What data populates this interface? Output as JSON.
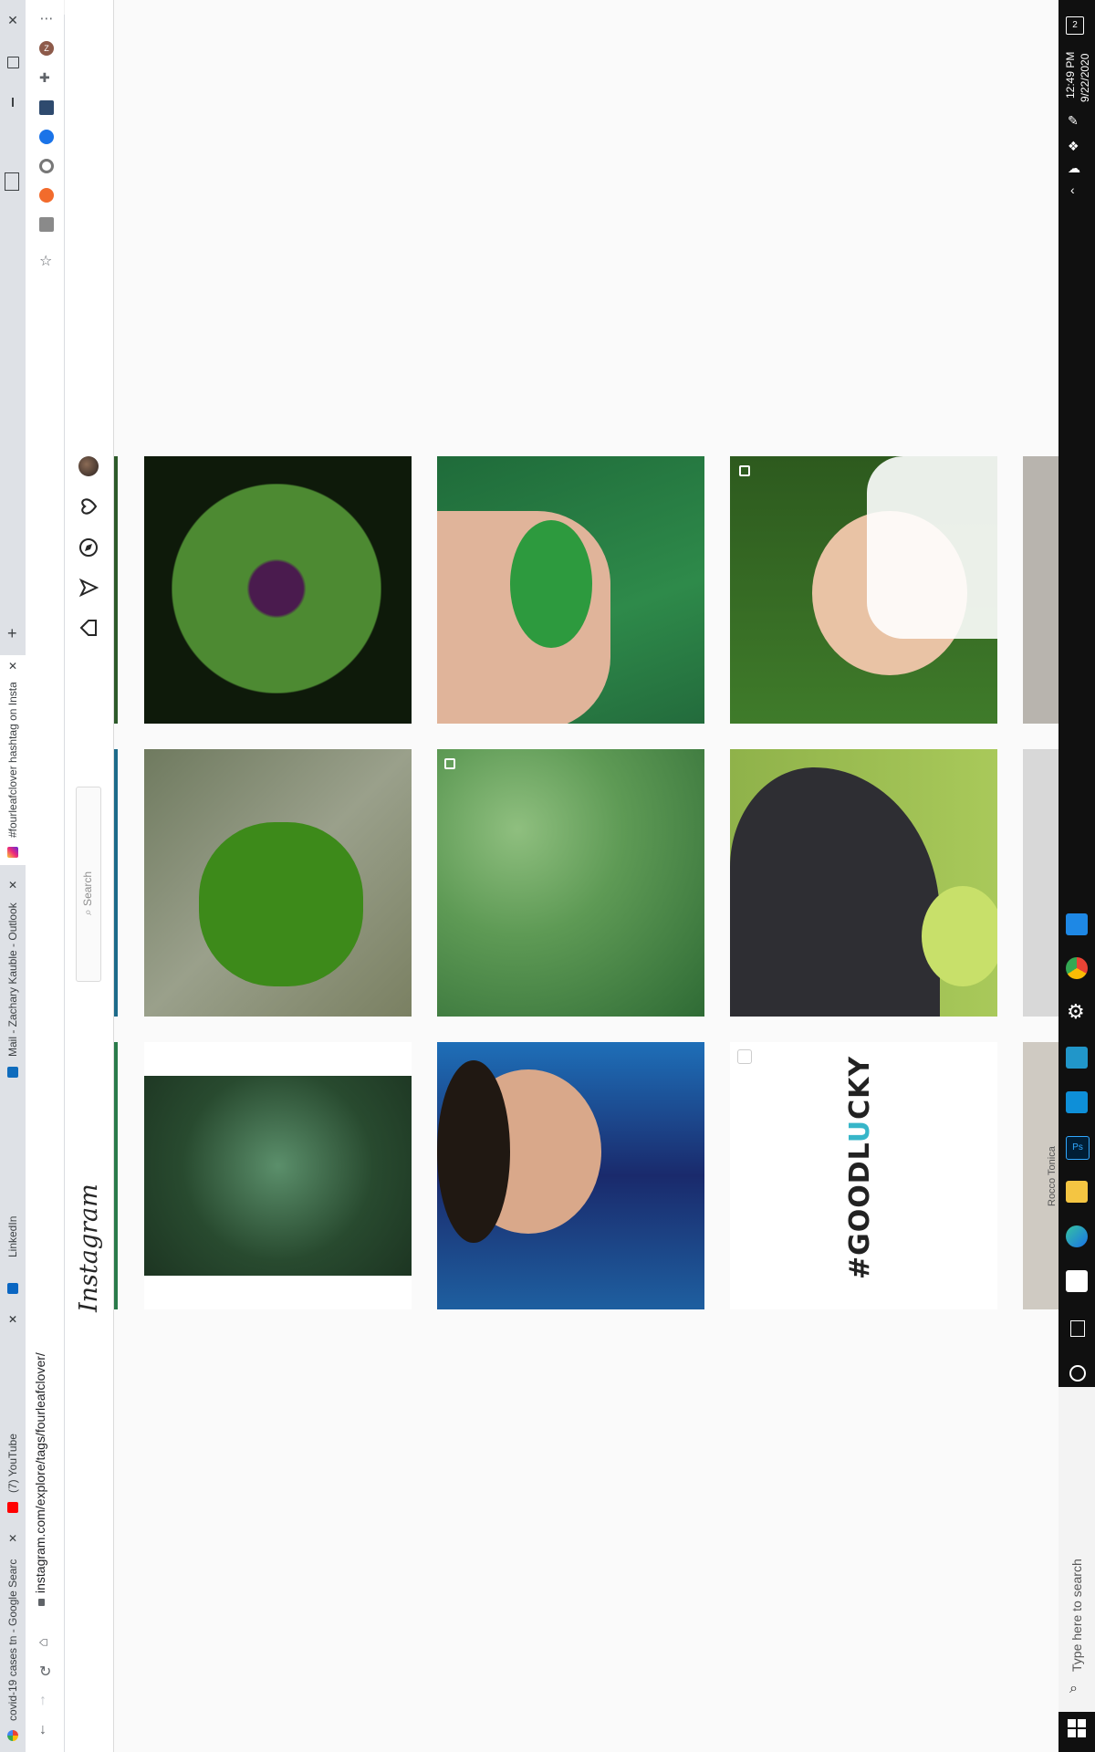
{
  "browser": {
    "tabs": [
      {
        "title": "covid-19 cases tn - Google Searc",
        "favicon": "google-icon"
      },
      {
        "title": "(7) YouTube",
        "favicon": "youtube-icon"
      },
      {
        "title": "LinkedIn",
        "favicon": "linkedin-icon"
      },
      {
        "title": "Mail - Zachary Kauble - Outlook",
        "favicon": "outlook-icon"
      },
      {
        "title": "#fourleafclover hashtag on Insta",
        "favicon": "instagram-icon",
        "active": true
      }
    ],
    "new_tab_label": "+",
    "url": "instagram.com/explore/tags/fourleafclover/",
    "profile_initial": "Z"
  },
  "instagram": {
    "logo": "Instagram",
    "search_placeholder": "Search",
    "nav_icons": [
      "home-icon",
      "direct-icon",
      "explore-icon",
      "activity-heart-icon",
      "profile-avatar-icon"
    ]
  },
  "posts": [
    {
      "id": "r1c1",
      "alt": "four leaf clover with water drops",
      "colors": [
        "#0e1a0a",
        "#3f7d2a",
        "#4a1b4e"
      ]
    },
    {
      "id": "r1c2",
      "alt": "hand holding four leaf clover",
      "colors": [
        "#1f6b3a",
        "#2e8a4a",
        "#e0b49a"
      ],
      "carousel": false
    },
    {
      "id": "r1c3",
      "alt": "smiling woman lying in clover",
      "colors": [
        "#2d5a1e",
        "#e9c3a5",
        "#ffffff"
      ],
      "carousel": true
    },
    {
      "id": "r2c1",
      "alt": "four leaf clover closeup",
      "colors": [
        "#6f7a5f",
        "#3d8a1a",
        "#9aa08b"
      ]
    },
    {
      "id": "r2c2",
      "alt": "patch of clover leaves",
      "colors": [
        "#5e9a55",
        "#2f6b35",
        "#8fbf7f"
      ],
      "carousel": true
    },
    {
      "id": "r2c3",
      "alt": "black dog with four leaf clover",
      "colors": [
        "#8fb24a",
        "#2e2e33",
        "#c8e06a"
      ]
    },
    {
      "id": "r3c1",
      "alt": "clover in grass",
      "colors": [
        "#284a2f",
        "#5b8f6b",
        "#1d3522"
      ]
    },
    {
      "id": "r3c2",
      "alt": "man in blue shirt selfie",
      "colors": [
        "#1a2a6c",
        "#1e6fb8",
        "#d9a88a"
      ]
    },
    {
      "id": "r3c3",
      "alt": "goodlucky text",
      "colors": [
        "#ffffff",
        "#222222",
        "#37b6c9"
      ],
      "text_before": "#GOODL",
      "text_accent": "U",
      "text_after": "CKY",
      "video": true
    }
  ],
  "partial_label": "Rocco Tonica",
  "taskbar": {
    "time": "12:49 PM",
    "date": "9/22/2020",
    "search_placeholder": "Type here to search"
  }
}
